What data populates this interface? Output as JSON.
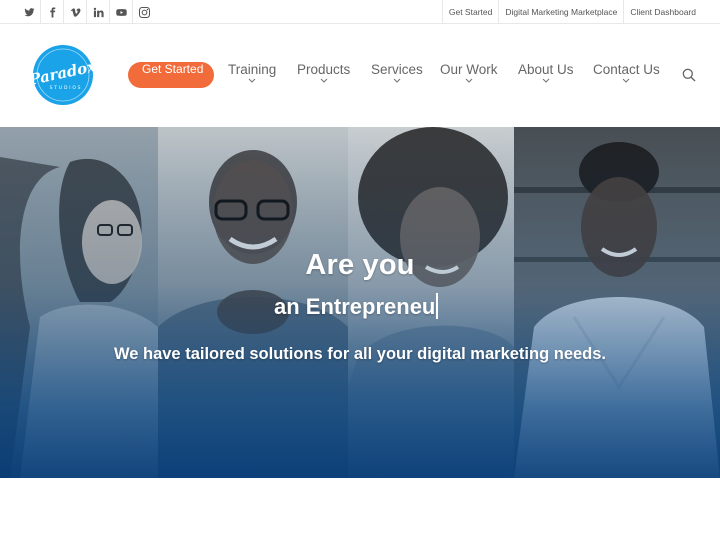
{
  "topbar": {
    "social_icons": [
      "twitter-icon",
      "facebook-icon",
      "vimeo-icon",
      "linkedin-icon",
      "youtube-icon",
      "instagram-icon"
    ],
    "links": [
      {
        "label": "Get Started"
      },
      {
        "label": "Digital Marketing Marketplace"
      },
      {
        "label": "Client Dashboard"
      }
    ]
  },
  "header": {
    "logo": {
      "brand": "Paradox",
      "sub": "STUDIOS",
      "color": "#1aa3e8"
    },
    "cta_label": "Get Started",
    "cta_color": "#f26b3a",
    "nav": [
      {
        "label": "Training"
      },
      {
        "label": "Products"
      },
      {
        "label": "Services"
      },
      {
        "label": "Our Work"
      },
      {
        "label": "About Us"
      },
      {
        "label": "Contact Us"
      }
    ],
    "search_icon": "search-icon"
  },
  "hero": {
    "headline": "Are you",
    "typed_text": "an Entrepreneu",
    "tagline": "We have tailored solutions for all your digital marketing needs.",
    "overlay_color": "#0a4a8a"
  }
}
